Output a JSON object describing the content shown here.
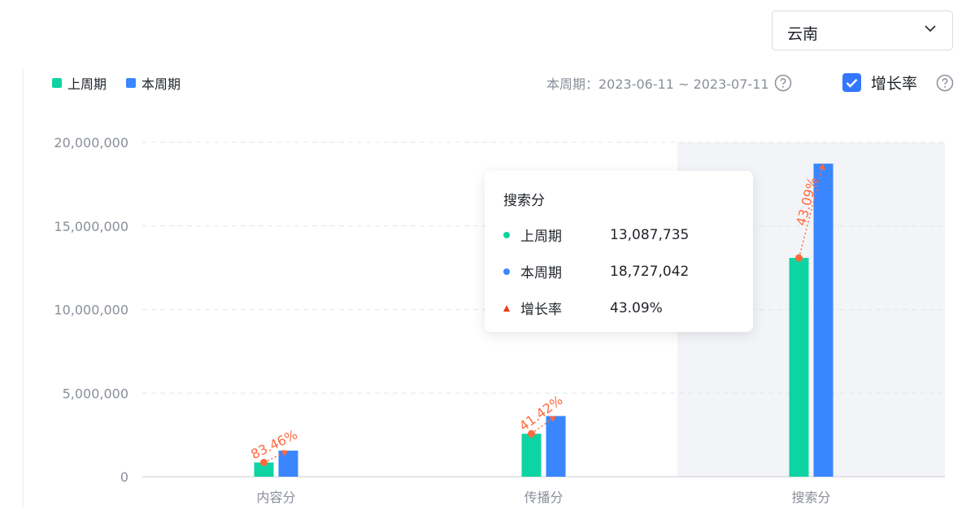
{
  "region_select": {
    "value": "云南"
  },
  "legend": {
    "items": [
      "上周期",
      "本周期"
    ]
  },
  "period": {
    "text": "本周期：2023-06-11 ~ 2023-07-11"
  },
  "growth_toggle": {
    "label": "增长率",
    "checked": true
  },
  "tooltip": {
    "title": "搜索分",
    "rows": [
      {
        "name": "上周期",
        "value": "13,087,735"
      },
      {
        "name": "本周期",
        "value": "18,727,042"
      },
      {
        "name": "增长率",
        "value": "43.09%"
      }
    ]
  },
  "colors": {
    "prev": "#0ed4a3",
    "curr": "#3a86ff",
    "growth": "#ff6a3d",
    "accent": "#3377ff",
    "highlight": "#f3f4f8"
  },
  "chart_data": {
    "type": "bar",
    "categories": [
      "内容分",
      "传播分",
      "搜索分"
    ],
    "series": [
      {
        "name": "上周期",
        "values": [
          850000,
          2570000,
          13087735
        ]
      },
      {
        "name": "本周期",
        "values": [
          1560000,
          3630000,
          18727042
        ]
      }
    ],
    "growth_rates": [
      "83.46%",
      "41.42%",
      "43.09%"
    ],
    "yticks": [
      "0",
      "5,000,000",
      "10,000,000",
      "15,000,000",
      "20,000,000"
    ],
    "ylim": [
      0,
      20000000
    ],
    "highlighted_category": "搜索分",
    "grid": true
  }
}
